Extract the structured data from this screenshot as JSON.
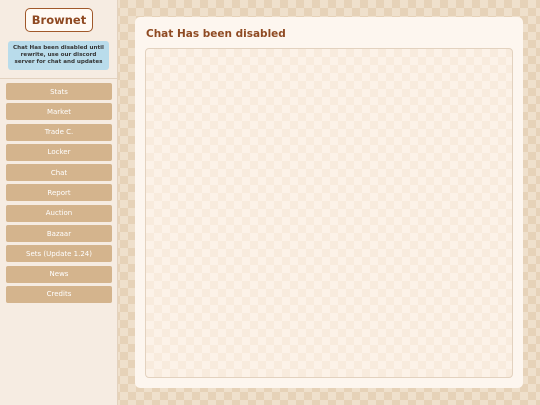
{
  "sidebar": {
    "logo": "Brownet",
    "notice": "Chat Has been disabled until rewrite, use our discord server for chat and updates",
    "items": [
      {
        "label": "Stats"
      },
      {
        "label": "Market"
      },
      {
        "label": "Trade C."
      },
      {
        "label": "Locker"
      },
      {
        "label": "Chat"
      },
      {
        "label": "Report"
      },
      {
        "label": "Auction"
      },
      {
        "label": "Bazaar"
      },
      {
        "label": "Sets (Update 1.24)"
      },
      {
        "label": "News"
      },
      {
        "label": "Credits"
      }
    ]
  },
  "main": {
    "title": "Chat Has been disabled"
  },
  "colors": {
    "accent": "#8f4a22",
    "nav_button": "#d4b48d",
    "notice_bg": "#b9dceb",
    "sidebar_bg": "#f6ece2",
    "card_bg": "#fdf6ef"
  }
}
